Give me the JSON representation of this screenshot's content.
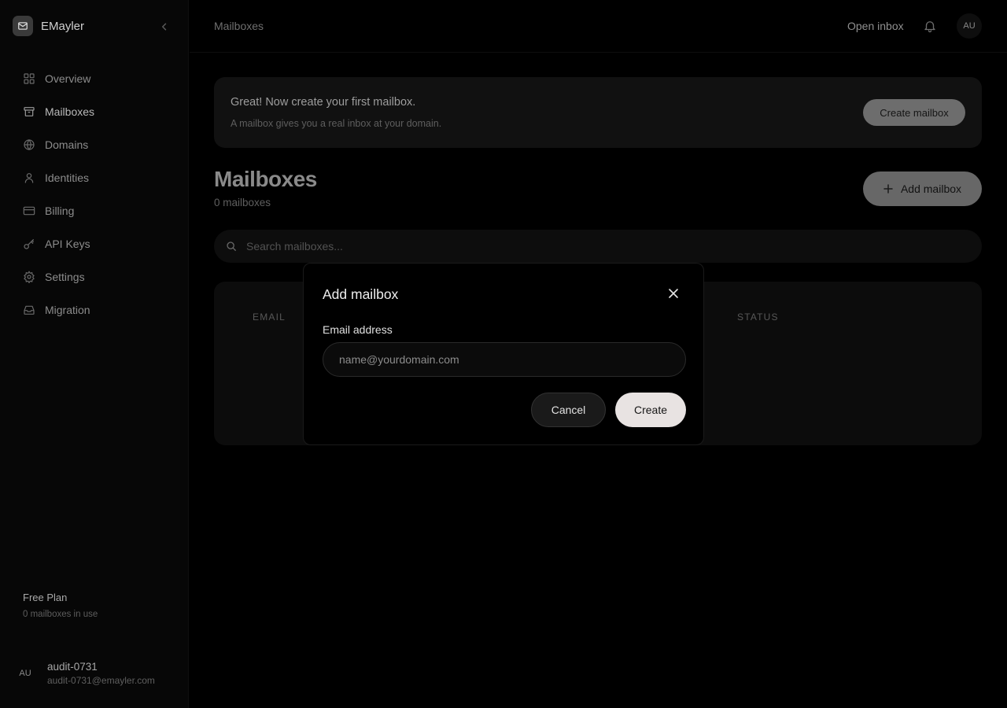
{
  "app": {
    "name": "EMayler"
  },
  "sidebar": {
    "items": [
      {
        "label": "Overview",
        "icon": "grid-icon"
      },
      {
        "label": "Mailboxes",
        "icon": "archive-icon"
      },
      {
        "label": "Domains",
        "icon": "globe-icon"
      },
      {
        "label": "Identities",
        "icon": "user-icon"
      },
      {
        "label": "Billing",
        "icon": "credit-card-icon"
      },
      {
        "label": "API Keys",
        "icon": "key-icon"
      },
      {
        "label": "Settings",
        "icon": "gear-icon"
      },
      {
        "label": "Migration",
        "icon": "inbox-icon"
      }
    ],
    "active": "Mailboxes",
    "plan": {
      "title": "Free Plan",
      "usage": "0 mailboxes in use"
    },
    "user": {
      "initials": "AU",
      "name": "audit-0731",
      "email": "audit-0731@emayler.com"
    }
  },
  "topbar": {
    "breadcrumb": "Mailboxes",
    "open_inbox": "Open inbox",
    "avatar_initials": "AU"
  },
  "banner": {
    "title": "Great! Now create your first mailbox.",
    "subtitle": "A mailbox gives you a real inbox at your domain.",
    "button": "Create mailbox"
  },
  "main": {
    "title": "Mailboxes",
    "count": "0 mailboxes",
    "add_button": "Add mailbox",
    "search_placeholder": "Search mailboxes...",
    "columns": [
      "EMAIL",
      "STATUS"
    ]
  },
  "modal": {
    "title": "Add mailbox",
    "field_label": "Email address",
    "email_placeholder": "name@yourdomain.com",
    "email_value": "",
    "cancel": "Cancel",
    "create": "Create"
  },
  "colors": {
    "background": "#000000",
    "create_button": "#e8e3e2"
  }
}
